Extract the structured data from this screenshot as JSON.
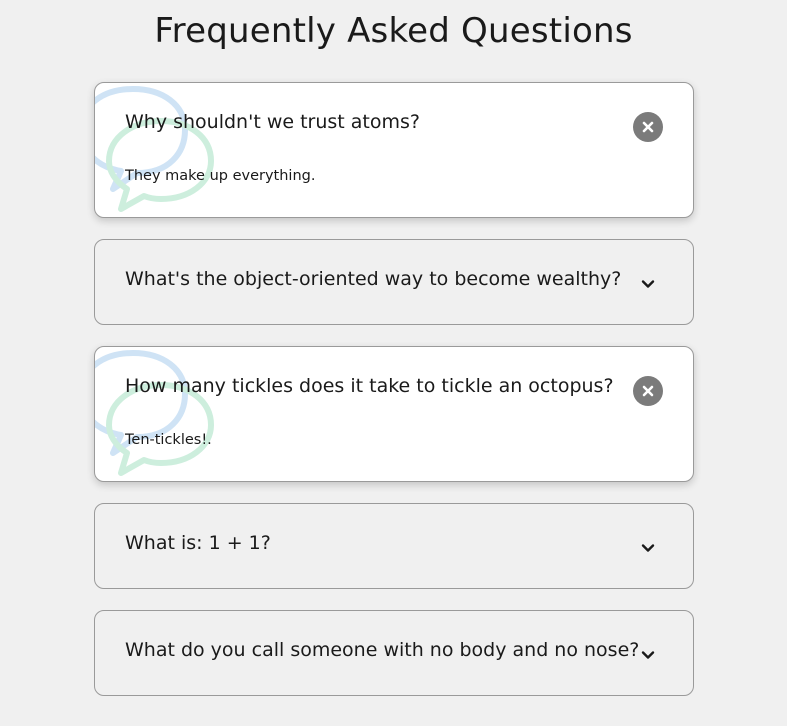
{
  "page": {
    "title": "Frequently Asked Questions"
  },
  "faqs": [
    {
      "question": "Why shouldn't we trust atoms?",
      "answer": "They make up everything.",
      "open": true
    },
    {
      "question": "What's the object-oriented way to become wealthy?",
      "answer": "",
      "open": false
    },
    {
      "question": "How many tickles does it take to tickle an octopus?",
      "answer": "Ten-tickles!.",
      "open": true
    },
    {
      "question": "What is: 1 + 1?",
      "answer": "",
      "open": false
    },
    {
      "question": "What do you call someone with no body and no nose?",
      "answer": "",
      "open": false
    }
  ],
  "icons": {
    "open_toggle": "close-icon",
    "closed_toggle": "chevron-down-icon",
    "decoration": "chat-bubbles-icon"
  },
  "colors": {
    "background": "#f0f0f0",
    "card_open": "#ffffff",
    "toggle_bg": "#7b7b7b",
    "bubble_blue": "#cfe3f5",
    "bubble_green": "#cdeedd"
  }
}
